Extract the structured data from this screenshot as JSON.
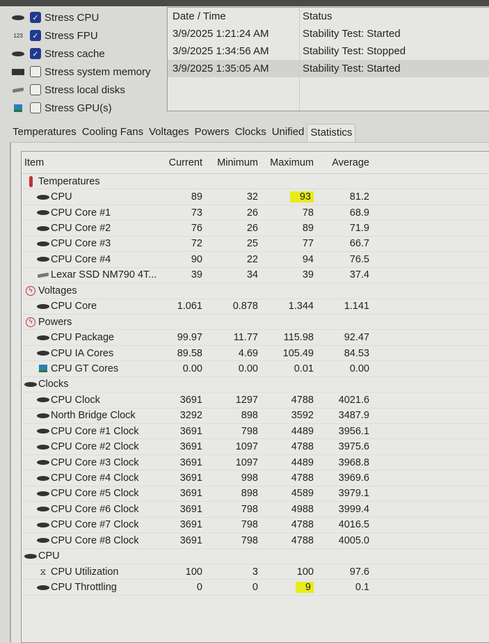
{
  "stress_options": [
    {
      "label": "Stress CPU",
      "checked": true,
      "icon": "cpu-chip-icon"
    },
    {
      "label": "Stress FPU",
      "checked": true,
      "icon": "fpu-123-icon"
    },
    {
      "label": "Stress cache",
      "checked": true,
      "icon": "cache-chip-icon"
    },
    {
      "label": "Stress system memory",
      "checked": false,
      "icon": "memory-module-icon"
    },
    {
      "label": "Stress local disks",
      "checked": false,
      "icon": "disk-icon"
    },
    {
      "label": "Stress GPU(s)",
      "checked": false,
      "icon": "gpu-icon"
    }
  ],
  "fpu_icon_text": "123",
  "log": {
    "headers": [
      "Date / Time",
      "Status"
    ],
    "rows": [
      {
        "time": "3/9/2025 1:21:24 AM",
        "status": "Stability Test: Started"
      },
      {
        "time": "3/9/2025 1:34:56 AM",
        "status": "Stability Test: Stopped"
      },
      {
        "time": "3/9/2025 1:35:05 AM",
        "status": "Stability Test: Started"
      }
    ]
  },
  "tabs": [
    "Temperatures",
    "Cooling Fans",
    "Voltages",
    "Powers",
    "Clocks",
    "Unified",
    "Statistics"
  ],
  "active_tab": "Statistics",
  "table": {
    "headers": [
      "Item",
      "Current",
      "Minimum",
      "Maximum",
      "Average"
    ],
    "rows": [
      {
        "type": "group",
        "name": "Temperatures",
        "icon": "thermometer-icon"
      },
      {
        "type": "item",
        "name": "CPU",
        "icon": "cpu-chip-icon",
        "cur": "89",
        "min": "32",
        "max": "93",
        "avg": "81.2",
        "hl": true
      },
      {
        "type": "item",
        "name": "CPU Core #1",
        "icon": "cpu-chip-icon",
        "cur": "73",
        "min": "26",
        "max": "78",
        "avg": "68.9"
      },
      {
        "type": "item",
        "name": "CPU Core #2",
        "icon": "cpu-chip-icon",
        "cur": "76",
        "min": "26",
        "max": "89",
        "avg": "71.9"
      },
      {
        "type": "item",
        "name": "CPU Core #3",
        "icon": "cpu-chip-icon",
        "cur": "72",
        "min": "25",
        "max": "77",
        "avg": "66.7"
      },
      {
        "type": "item",
        "name": "CPU Core #4",
        "icon": "cpu-chip-icon",
        "cur": "90",
        "min": "22",
        "max": "94",
        "avg": "76.5"
      },
      {
        "type": "item",
        "name": "Lexar SSD NM790 4T...",
        "icon": "disk-icon",
        "cur": "39",
        "min": "34",
        "max": "39",
        "avg": "37.4"
      },
      {
        "type": "group",
        "name": "Voltages",
        "icon": "bolt-icon"
      },
      {
        "type": "item",
        "name": "CPU Core",
        "icon": "cpu-chip-icon",
        "cur": "1.061",
        "min": "0.878",
        "max": "1.344",
        "avg": "1.141"
      },
      {
        "type": "group",
        "name": "Powers",
        "icon": "bolt-icon"
      },
      {
        "type": "item",
        "name": "CPU Package",
        "icon": "cpu-chip-icon",
        "cur": "99.97",
        "min": "11.77",
        "max": "115.98",
        "avg": "92.47"
      },
      {
        "type": "item",
        "name": "CPU IA Cores",
        "icon": "cpu-chip-icon",
        "cur": "89.58",
        "min": "4.69",
        "max": "105.49",
        "avg": "84.53"
      },
      {
        "type": "item",
        "name": "CPU GT Cores",
        "icon": "gpu-icon",
        "cur": "0.00",
        "min": "0.00",
        "max": "0.01",
        "avg": "0.00"
      },
      {
        "type": "group",
        "name": "Clocks",
        "icon": "clock-chip-icon"
      },
      {
        "type": "item",
        "name": "CPU Clock",
        "icon": "cpu-chip-icon",
        "cur": "3691",
        "min": "1297",
        "max": "4788",
        "avg": "4021.6"
      },
      {
        "type": "item",
        "name": "North Bridge Clock",
        "icon": "chipset-icon",
        "cur": "3292",
        "min": "898",
        "max": "3592",
        "avg": "3487.9"
      },
      {
        "type": "item",
        "name": "CPU Core #1 Clock",
        "icon": "cpu-chip-icon",
        "cur": "3691",
        "min": "798",
        "max": "4489",
        "avg": "3956.1"
      },
      {
        "type": "item",
        "name": "CPU Core #2 Clock",
        "icon": "cpu-chip-icon",
        "cur": "3691",
        "min": "1097",
        "max": "4788",
        "avg": "3975.6"
      },
      {
        "type": "item",
        "name": "CPU Core #3 Clock",
        "icon": "cpu-chip-icon",
        "cur": "3691",
        "min": "1097",
        "max": "4489",
        "avg": "3968.8"
      },
      {
        "type": "item",
        "name": "CPU Core #4 Clock",
        "icon": "cpu-chip-icon",
        "cur": "3691",
        "min": "998",
        "max": "4788",
        "avg": "3969.6"
      },
      {
        "type": "item",
        "name": "CPU Core #5 Clock",
        "icon": "cpu-chip-icon",
        "cur": "3691",
        "min": "898",
        "max": "4589",
        "avg": "3979.1"
      },
      {
        "type": "item",
        "name": "CPU Core #6 Clock",
        "icon": "cpu-chip-icon",
        "cur": "3691",
        "min": "798",
        "max": "4988",
        "avg": "3999.4"
      },
      {
        "type": "item",
        "name": "CPU Core #7 Clock",
        "icon": "cpu-chip-icon",
        "cur": "3691",
        "min": "798",
        "max": "4788",
        "avg": "4016.5"
      },
      {
        "type": "item",
        "name": "CPU Core #8 Clock",
        "icon": "cpu-chip-icon",
        "cur": "3691",
        "min": "798",
        "max": "4788",
        "avg": "4005.0"
      },
      {
        "type": "group",
        "name": "CPU",
        "icon": "cpu-chip-icon"
      },
      {
        "type": "item",
        "name": "CPU Utilization",
        "icon": "hourglass-icon",
        "cur": "100",
        "min": "3",
        "max": "100",
        "avg": "97.6"
      },
      {
        "type": "item",
        "name": "CPU Throttling",
        "icon": "cpu-chip-icon",
        "cur": "0",
        "min": "0",
        "max": "9",
        "avg": "0.1",
        "hl": true
      }
    ]
  },
  "colors": {
    "highlight": "#e8ec1a",
    "checkbox": "#1f3a8f"
  }
}
